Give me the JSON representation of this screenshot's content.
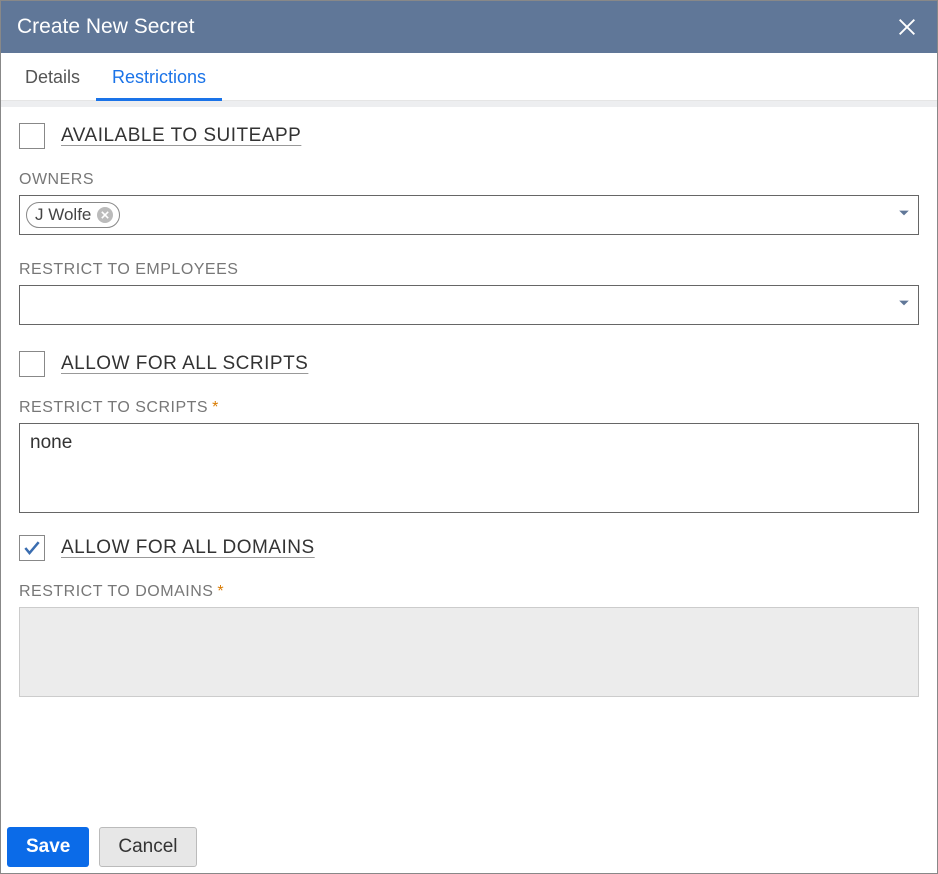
{
  "header": {
    "title": "Create New Secret"
  },
  "tabs": {
    "details": "Details",
    "restrictions": "Restrictions",
    "active": "restrictions"
  },
  "form": {
    "available_to_suiteapp": {
      "label": "AVAILABLE TO SUITEAPP",
      "checked": false
    },
    "owners": {
      "label": "OWNERS",
      "chips": [
        "J Wolfe"
      ]
    },
    "restrict_to_employees": {
      "label": "RESTRICT TO EMPLOYEES",
      "value": ""
    },
    "allow_for_all_scripts": {
      "label": "ALLOW FOR ALL SCRIPTS",
      "checked": false
    },
    "restrict_to_scripts": {
      "label": "RESTRICT TO SCRIPTS",
      "required": true,
      "value": "none"
    },
    "allow_for_all_domains": {
      "label": "ALLOW FOR ALL DOMAINS",
      "checked": true
    },
    "restrict_to_domains": {
      "label": "RESTRICT TO DOMAINS",
      "required": true,
      "value": "",
      "disabled": true
    }
  },
  "buttons": {
    "save": "Save",
    "cancel": "Cancel"
  }
}
